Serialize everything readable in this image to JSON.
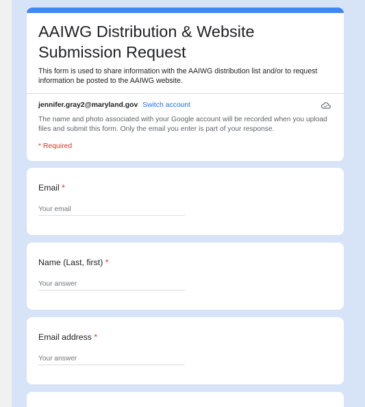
{
  "form": {
    "title": "AAIWG Distribution & Website Submission Request",
    "description": "This form is used to share information with the AAIWG distribution list and/or to request information be posted to the AAIWG website.",
    "account_email": "jennifer.gray2@maryland.gov",
    "switch_account_label": "Switch account",
    "notice": "The name and photo associated with your Google account will be recorded when you upload files and submit this form. Only the email you enter is part of your response.",
    "required_note": "* Required"
  },
  "questions": [
    {
      "label": "Email",
      "required_mark": "*",
      "placeholder": "Your email"
    },
    {
      "label": "Name (Last, first)",
      "required_mark": "*",
      "placeholder": "Your answer"
    },
    {
      "label": "Email address",
      "required_mark": "*",
      "placeholder": "Your answer"
    }
  ],
  "colors": {
    "accent": "#4285f4",
    "background": "#d7e3f7",
    "required": "#d93025",
    "link": "#1a73e8"
  },
  "icons": {
    "cloud": "cloud-save-icon"
  }
}
